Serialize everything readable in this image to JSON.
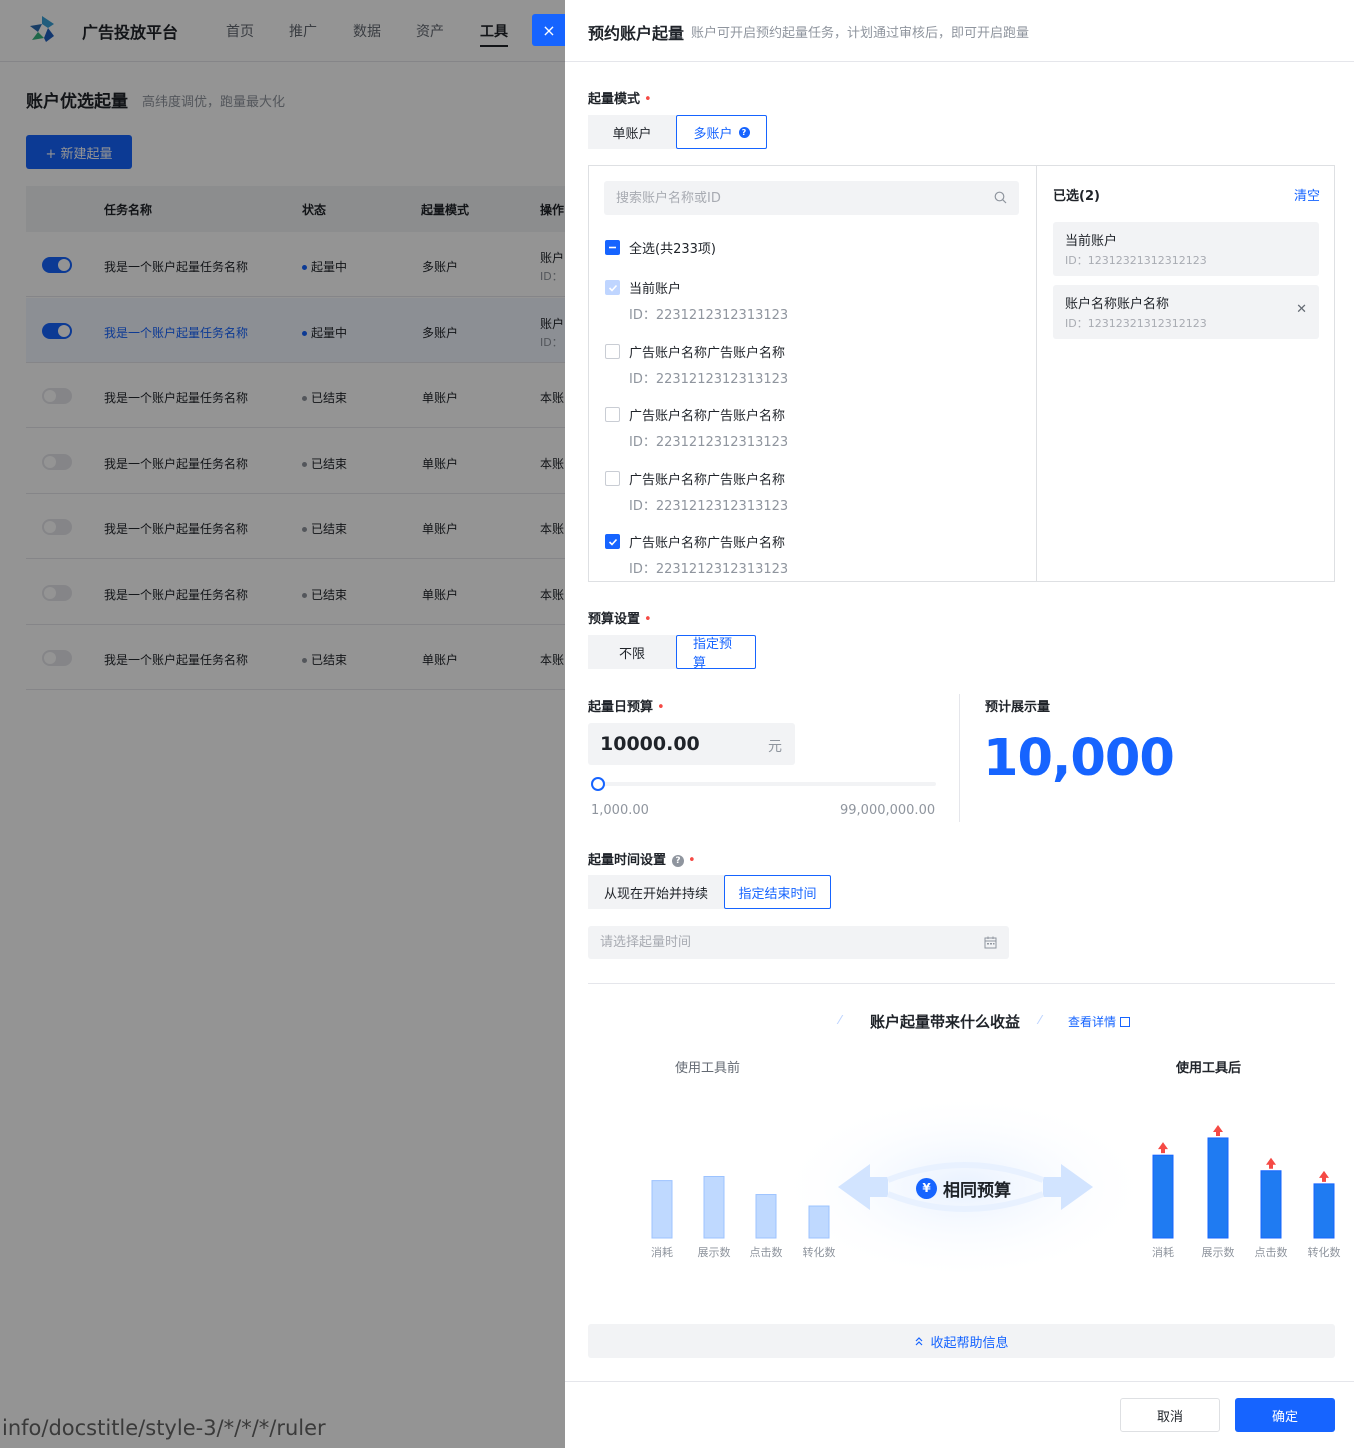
{
  "nav": {
    "brand": "广告投放平台",
    "items": [
      "首页",
      "推广",
      "数据",
      "资产",
      "工具"
    ],
    "active": "工具"
  },
  "page": {
    "title": "账户优选起量",
    "subtitle": "高纬度调优，跑量最大化",
    "new_button": "+ 新建起量"
  },
  "table": {
    "headers": [
      "任务名称",
      "状态",
      "起量模式",
      "操作"
    ],
    "rows": [
      {
        "name": "我是一个账户起量任务名称",
        "status": "起量中",
        "mode": "多账户",
        "op": "账户",
        "op_sub": "ID：",
        "on": true,
        "highlight": false
      },
      {
        "name": "我是一个账户起量任务名称",
        "status": "起量中",
        "mode": "多账户",
        "op": "账户",
        "op_sub": "ID：",
        "on": true,
        "highlight": true
      },
      {
        "name": "我是一个账户起量任务名称",
        "status": "已结束",
        "mode": "单账户",
        "op": "本账",
        "op_sub": "",
        "on": false,
        "highlight": false
      },
      {
        "name": "我是一个账户起量任务名称",
        "status": "已结束",
        "mode": "单账户",
        "op": "本账",
        "op_sub": "",
        "on": false,
        "highlight": false
      },
      {
        "name": "我是一个账户起量任务名称",
        "status": "已结束",
        "mode": "单账户",
        "op": "本账",
        "op_sub": "",
        "on": false,
        "highlight": false
      },
      {
        "name": "我是一个账户起量任务名称",
        "status": "已结束",
        "mode": "单账户",
        "op": "本账",
        "op_sub": "",
        "on": false,
        "highlight": false
      },
      {
        "name": "我是一个账户起量任务名称",
        "status": "已结束",
        "mode": "单账户",
        "op": "本账",
        "op_sub": "",
        "on": false,
        "highlight": false
      }
    ]
  },
  "close_icon": "×",
  "watermark": "info/docstitle/style-3/*/*/*/ruler",
  "drawer": {
    "title": "预约账户起量",
    "subtitle": "账户可开启预约起量任务，计划通过审核后，即可开启跑量",
    "mode_label": "起量模式",
    "mode_options": [
      "单账户",
      "多账户"
    ],
    "mode_selected": 1,
    "search_placeholder": "搜索账户名称或ID",
    "select_all": "全选(共233项)",
    "accounts": [
      {
        "name": "当前账户",
        "id": "ID：2231212312313123",
        "state": "disabled-checked"
      },
      {
        "name": "广告账户名称广告账户名称",
        "id": "ID：2231212312313123",
        "state": "unchecked"
      },
      {
        "name": "广告账户名称广告账户名称",
        "id": "ID：2231212312313123",
        "state": "unchecked"
      },
      {
        "name": "广告账户名称广告账户名称",
        "id": "ID：2231212312313123",
        "state": "unchecked"
      },
      {
        "name": "广告账户名称广告账户名称",
        "id": "ID：2231212312313123",
        "state": "checked"
      }
    ],
    "selected_title": "已选(2)",
    "clear": "清空",
    "selected": [
      {
        "name": "当前账户",
        "id": "ID：12312321312312123",
        "removable": false
      },
      {
        "name": "账户名称账户名称",
        "id": "ID：12312321312312123",
        "removable": true
      }
    ],
    "budget_label": "预算设置",
    "budget_options": [
      "不限",
      "指定预算"
    ],
    "budget_selected": 1,
    "daily_budget_label": "起量日预算",
    "daily_budget_value": "10000.00",
    "daily_budget_unit": "元",
    "slider_min": "1,000.00",
    "slider_max": "99,000,000.00",
    "slider_fraction": 0.0,
    "estimate_label": "预计展示量",
    "estimate_value": "10,000",
    "time_label": "起量时间设置",
    "time_options": [
      "从现在开始并持续",
      "指定结束时间"
    ],
    "time_selected": 1,
    "time_placeholder": "请选择起量时间",
    "benefit_title": "账户起量带来什么收益",
    "detail_link": "查看详情",
    "before_label": "使用工具前",
    "after_label": "使用工具后",
    "middle_label": "相同预算",
    "yen_symbol": "¥",
    "collapse_label": "收起帮助信息",
    "cancel": "取消",
    "confirm": "确定"
  },
  "chart_data": {
    "type": "bar",
    "categories": [
      "消耗",
      "展示数",
      "点击数",
      "转化数"
    ],
    "series": [
      {
        "name": "使用工具前",
        "values": [
          70,
          75,
          53,
          39
        ]
      },
      {
        "name": "使用工具后",
        "values": [
          101,
          122,
          82,
          66
        ]
      }
    ],
    "colors": {
      "before": "#bfd9ff",
      "after": "#1f7bf2",
      "arrow": "#f54a45"
    }
  }
}
